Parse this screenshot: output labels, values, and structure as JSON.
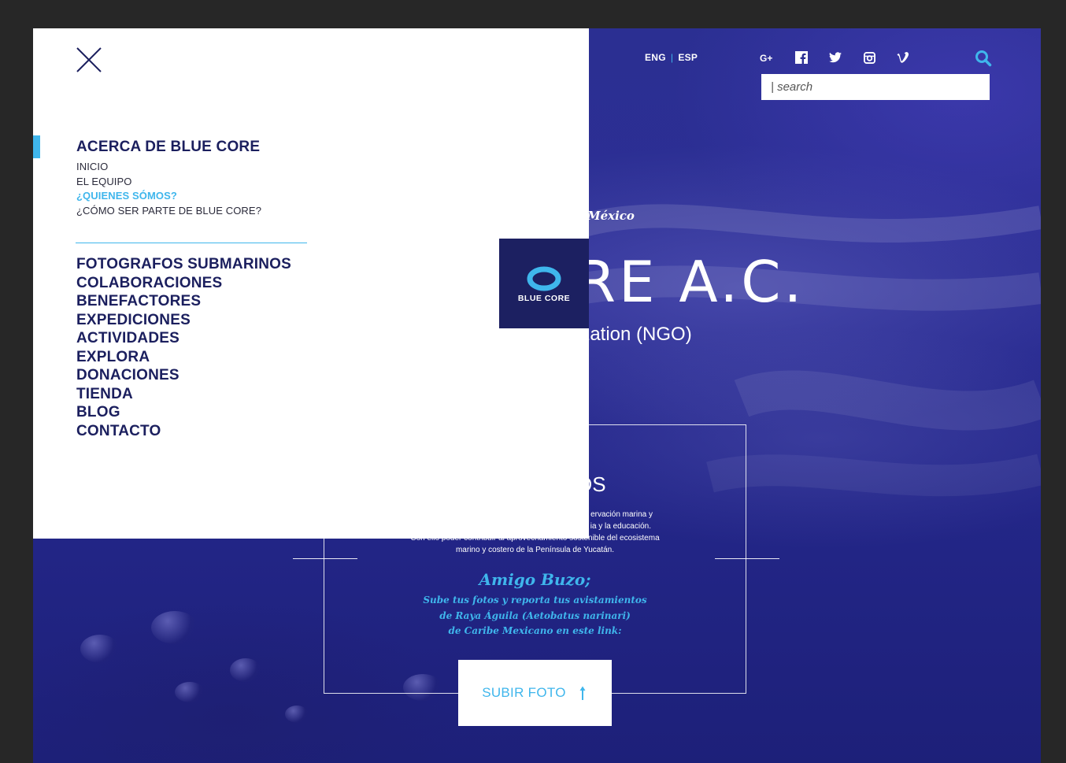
{
  "header": {
    "lang_eng": "ENG",
    "lang_sep": "|",
    "lang_esp": "ESP",
    "social": [
      "google-plus-icon",
      "facebook-icon",
      "twitter-icon",
      "instagram-icon",
      "vimeo-icon"
    ],
    "search_placeholder": "| search"
  },
  "hero": {
    "location": "México",
    "title": "RE A.C.",
    "subtitle": "ization (NGO)"
  },
  "card": {
    "heading": "OS",
    "text_lines": [
      "ervación marina y",
      "ia y la educación.",
      "Con ello poder contribuir al aprovechamiento sostenible del ecosistema",
      "marino y costero de la Península de Yucatán."
    ],
    "amigo_title": "Amigo Buzo;",
    "amigo_lines": [
      "Sube tus fotos y reporta tus avistamientos",
      "de Raya Águila  (Aetobatus narinari)",
      "de Caribe Mexicano en este link:"
    ],
    "upload_label": "SUBIR FOTO"
  },
  "menu": {
    "section_title": "ACERCA DE BLUE CORE",
    "submenu": [
      {
        "label": "INICIO",
        "active": false
      },
      {
        "label": "EL EQUIPO",
        "active": false
      },
      {
        "label": "¿QUIENES SÓMOS?",
        "active": true
      },
      {
        "label": "¿CÓMO SER PARTE DE BLUE CORE?",
        "active": false
      }
    ],
    "items": [
      "FOTOGRAFOS SUBMARINOS",
      "COLABORACIONES",
      "BENEFACTORES",
      "EXPEDICIONES",
      "ACTIVIDADES",
      "EXPLORA",
      "DONACIONES",
      "TIENDA",
      "BLOG",
      "CONTACTO"
    ]
  },
  "logo": {
    "text": "BLUE CORE"
  },
  "colors": {
    "accent": "#3fb6ec",
    "navy": "#1b1f5e",
    "background": "#2b2f92"
  }
}
